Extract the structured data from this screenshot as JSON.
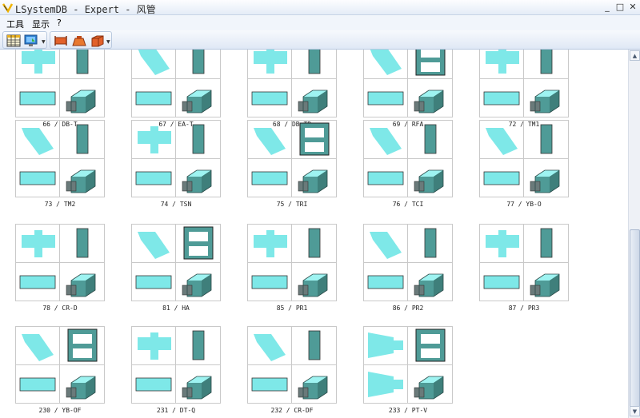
{
  "window": {
    "title": "LSystemDB - Expert - 风管",
    "minimize": "_",
    "restore": "□",
    "close": "✕"
  },
  "menu": [
    {
      "label": "工具"
    },
    {
      "label": "显示"
    },
    {
      "label": "?"
    }
  ],
  "toolbar": {
    "icons": [
      "table-view-icon",
      "monitor-icon",
      "duct-fitting-icon",
      "duct-transition-icon",
      "duct-box-icon"
    ]
  },
  "colors": {
    "duct_face": "#7ee8e8",
    "duct_side": "#4f9b97",
    "duct_dark": "#5e6e6e",
    "grid": "#c9c9c9"
  },
  "fittings": [
    {
      "label": "66 / DB-T"
    },
    {
      "label": "67 / EA-T"
    },
    {
      "label": "68 / DB-TR"
    },
    {
      "label": "69 / RFA"
    },
    {
      "label": "72 / TM1"
    },
    {
      "label": "73 / TM2"
    },
    {
      "label": "74 / TSN"
    },
    {
      "label": "75 / TRI"
    },
    {
      "label": "76 / TCI"
    },
    {
      "label": "77 / YB-O"
    },
    {
      "label": "78 / CR-D"
    },
    {
      "label": "81 / HA"
    },
    {
      "label": "85 / PR1"
    },
    {
      "label": "86 / PR2"
    },
    {
      "label": "87 / PR3"
    },
    {
      "label": "230 / YB-OF"
    },
    {
      "label": "231 / DT-Q"
    },
    {
      "label": "232 / CR-DF"
    },
    {
      "label": "233 / PT-V"
    }
  ]
}
